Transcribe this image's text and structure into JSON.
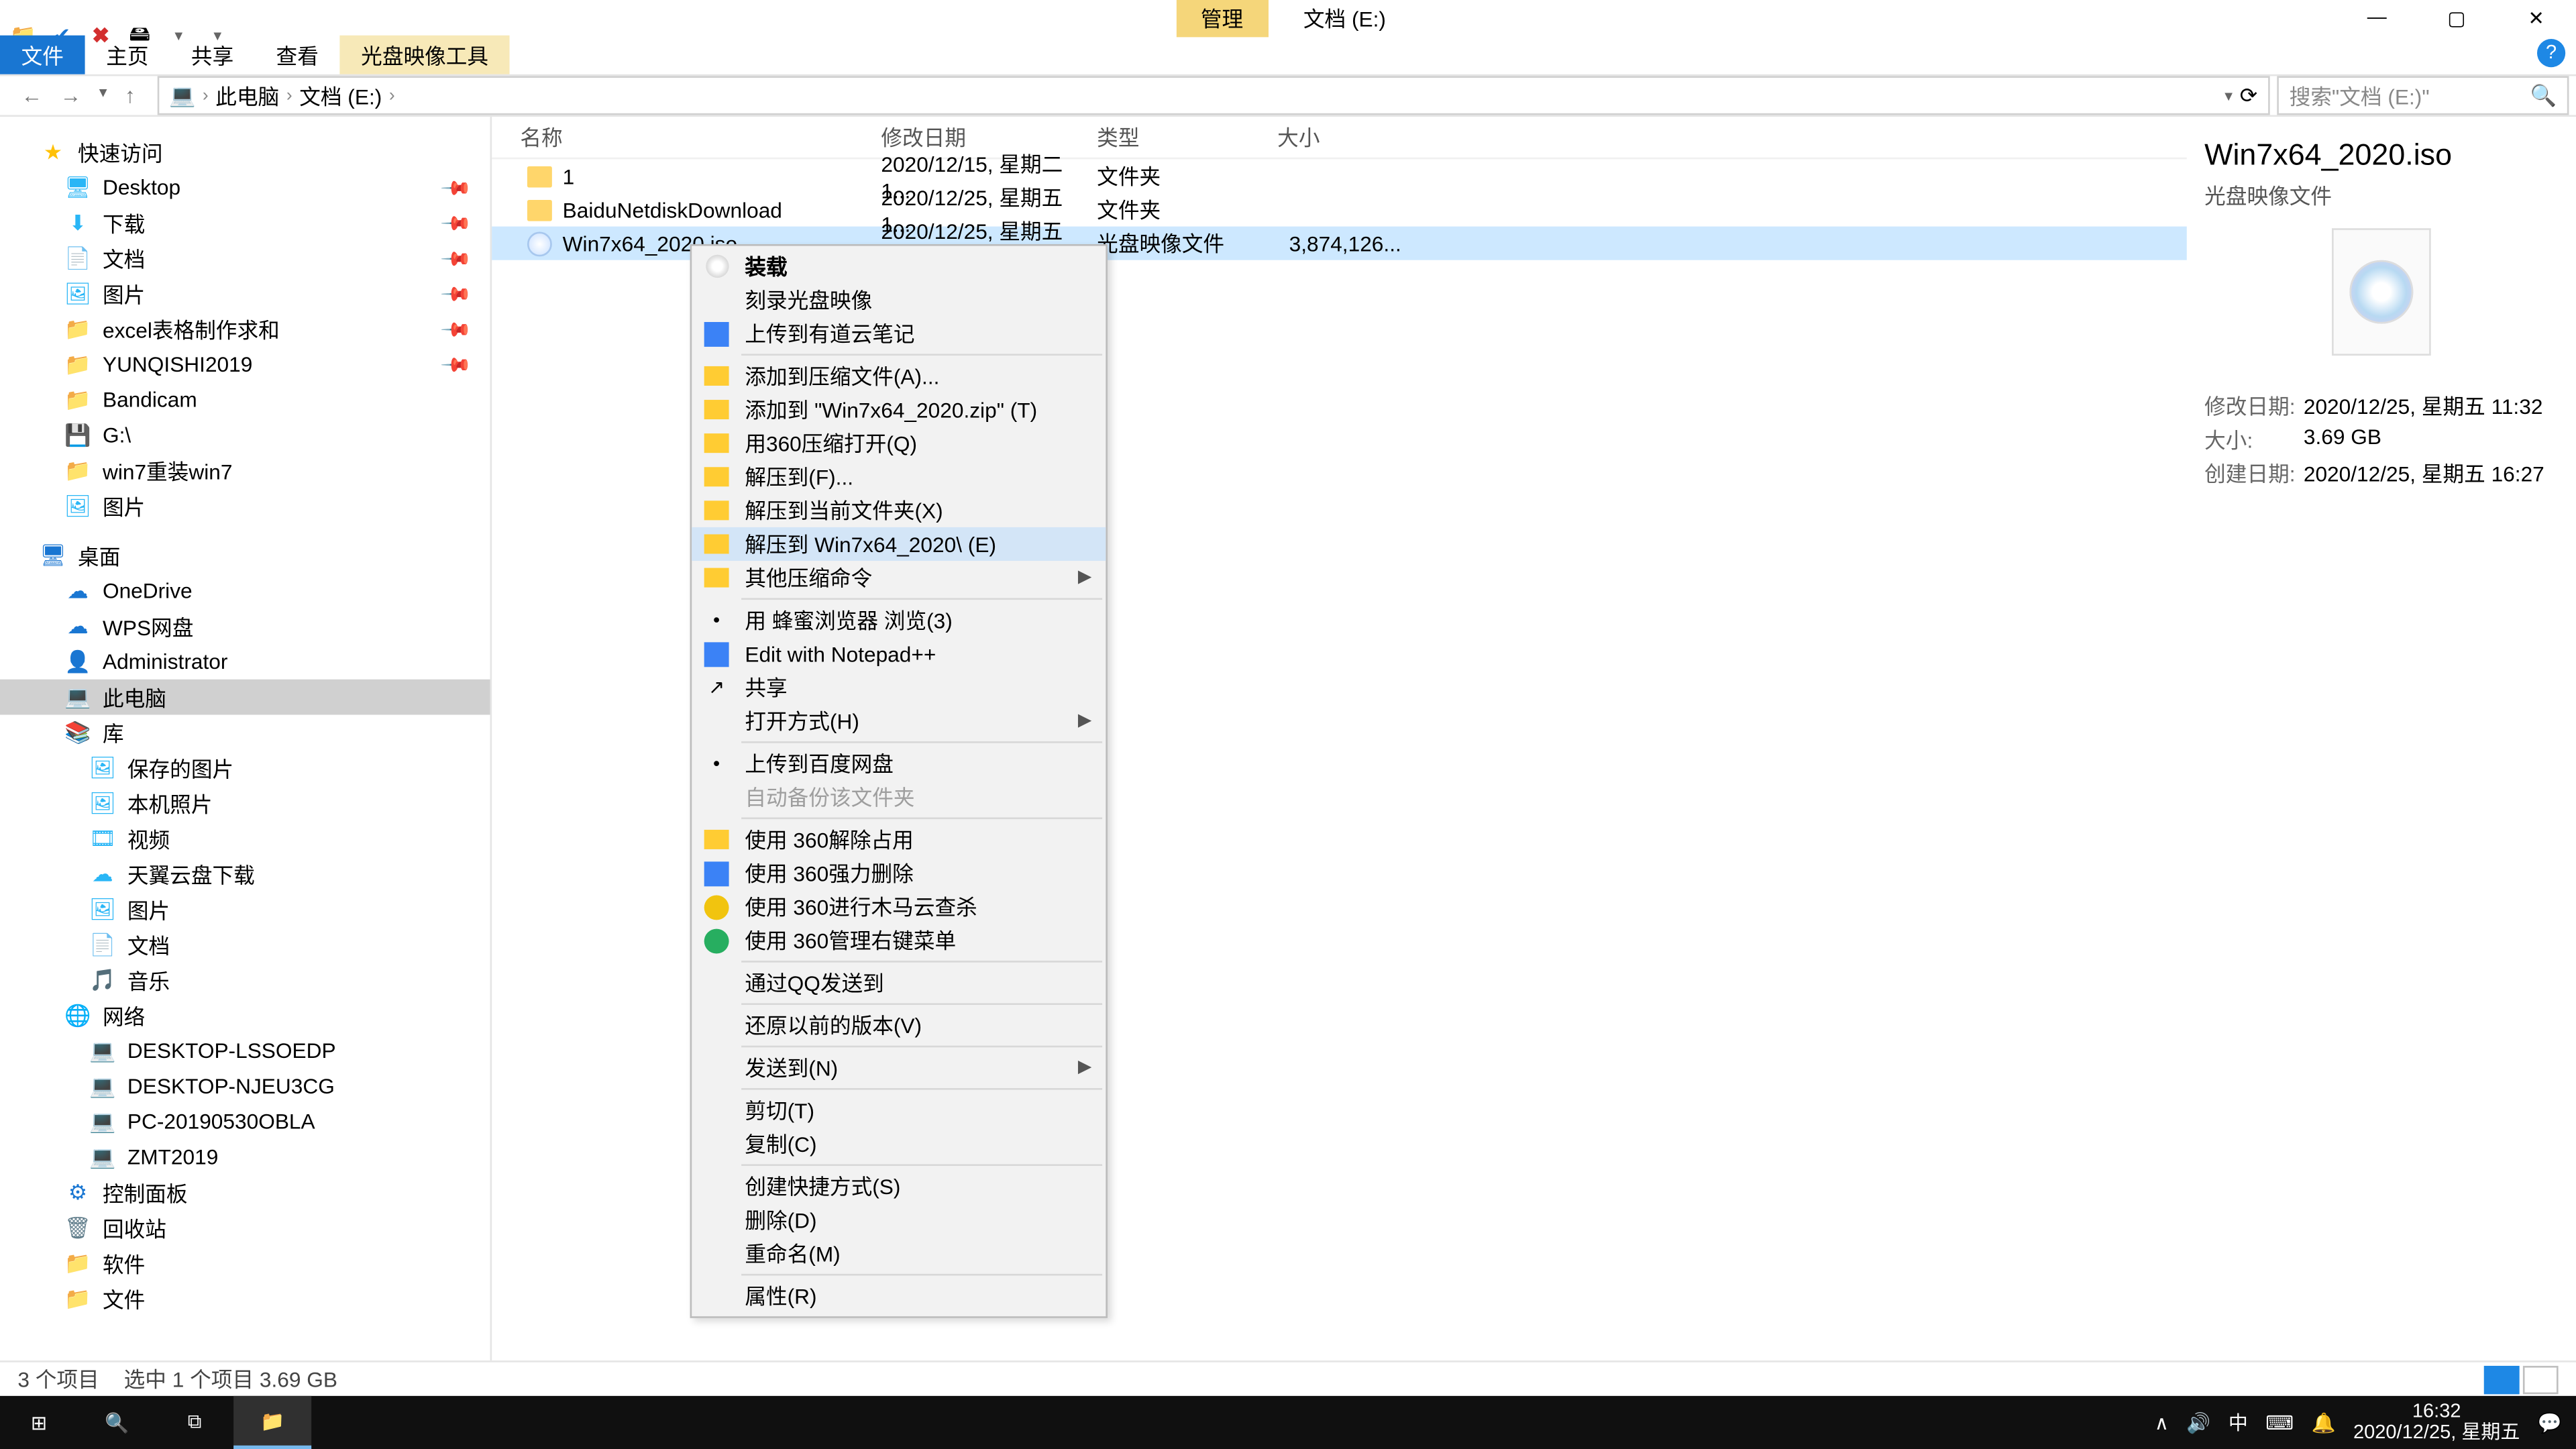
{
  "window": {
    "qat": [
      "📁",
      "✔",
      "✖",
      "🖴",
      "▾",
      "▾"
    ],
    "title_tab": "管理",
    "title_location": "文档 (E:)",
    "ribbon": {
      "file": "文件",
      "home": "主页",
      "share": "共享",
      "view": "查看",
      "tool": "光盘映像工具"
    },
    "ctrl": {
      "min": "—",
      "max": "▢",
      "close": "✕",
      "help": "?"
    }
  },
  "address": {
    "back": "←",
    "fwd": "→",
    "up": "↑",
    "crumbs": [
      "此电脑",
      "文档 (E:)"
    ],
    "search_ph": "搜索\"文档 (E:)\""
  },
  "tree": [
    {
      "lvl": 1,
      "icon": "★",
      "label": "快速访问",
      "col": "#ffc107"
    },
    {
      "lvl": 2,
      "icon": "🖥",
      "label": "Desktop",
      "col": "#29b6f6",
      "pin": true
    },
    {
      "lvl": 2,
      "icon": "⬇",
      "label": "下载",
      "col": "#29b6f6",
      "pin": true
    },
    {
      "lvl": 2,
      "icon": "📄",
      "label": "文档",
      "col": "#29b6f6",
      "pin": true
    },
    {
      "lvl": 2,
      "icon": "🖼",
      "label": "图片",
      "col": "#29b6f6",
      "pin": true
    },
    {
      "lvl": 2,
      "icon": "📁",
      "label": "excel表格制作求和",
      "col": "#ffc107",
      "pin": true
    },
    {
      "lvl": 2,
      "icon": "📁",
      "label": "YUNQISHI2019",
      "col": "#ffc107",
      "pin": true
    },
    {
      "lvl": 2,
      "icon": "📁",
      "label": "Bandicam",
      "col": "#ffc107"
    },
    {
      "lvl": 2,
      "icon": "💾",
      "label": "G:\\",
      "col": "#90a4ae"
    },
    {
      "lvl": 2,
      "icon": "📁",
      "label": "win7重装win7",
      "col": "#ffc107"
    },
    {
      "lvl": 2,
      "icon": "🖼",
      "label": "图片",
      "col": "#29b6f6"
    },
    {
      "gap": true
    },
    {
      "lvl": 1,
      "icon": "🖥",
      "label": "桌面",
      "col": "#1976d2"
    },
    {
      "lvl": 2,
      "icon": "☁",
      "label": "OneDrive",
      "col": "#1976d2"
    },
    {
      "lvl": 2,
      "icon": "☁",
      "label": "WPS网盘",
      "col": "#1976d2"
    },
    {
      "lvl": 2,
      "icon": "👤",
      "label": "Administrator",
      "col": "#607d8b"
    },
    {
      "lvl": 2,
      "icon": "💻",
      "label": "此电脑",
      "col": "#607d8b",
      "selected": true
    },
    {
      "lvl": 2,
      "icon": "📚",
      "label": "库",
      "col": "#29b6f6"
    },
    {
      "lvl": 3,
      "icon": "🖼",
      "label": "保存的图片",
      "col": "#29b6f6"
    },
    {
      "lvl": 3,
      "icon": "🖼",
      "label": "本机照片",
      "col": "#29b6f6"
    },
    {
      "lvl": 3,
      "icon": "🎞",
      "label": "视频",
      "col": "#29b6f6"
    },
    {
      "lvl": 3,
      "icon": "☁",
      "label": "天翼云盘下载",
      "col": "#29b6f6"
    },
    {
      "lvl": 3,
      "icon": "🖼",
      "label": "图片",
      "col": "#29b6f6"
    },
    {
      "lvl": 3,
      "icon": "📄",
      "label": "文档",
      "col": "#29b6f6"
    },
    {
      "lvl": 3,
      "icon": "🎵",
      "label": "音乐",
      "col": "#29b6f6"
    },
    {
      "lvl": 2,
      "icon": "🌐",
      "label": "网络",
      "col": "#1976d2"
    },
    {
      "lvl": 3,
      "icon": "💻",
      "label": "DESKTOP-LSSOEDP",
      "col": "#607d8b"
    },
    {
      "lvl": 3,
      "icon": "💻",
      "label": "DESKTOP-NJEU3CG",
      "col": "#607d8b"
    },
    {
      "lvl": 3,
      "icon": "💻",
      "label": "PC-20190530OBLA",
      "col": "#607d8b"
    },
    {
      "lvl": 3,
      "icon": "💻",
      "label": "ZMT2019",
      "col": "#607d8b"
    },
    {
      "lvl": 2,
      "icon": "⚙",
      "label": "控制面板",
      "col": "#1976d2"
    },
    {
      "lvl": 2,
      "icon": "🗑",
      "label": "回收站",
      "col": "#607d8b"
    },
    {
      "lvl": 2,
      "icon": "📁",
      "label": "软件",
      "col": "#ffc107"
    },
    {
      "lvl": 2,
      "icon": "📁",
      "label": "文件",
      "col": "#ffc107"
    }
  ],
  "columns": {
    "name": "名称",
    "date": "修改日期",
    "type": "类型",
    "size": "大小"
  },
  "files": [
    {
      "kind": "folder",
      "name": "1",
      "date": "2020/12/15, 星期二 1...",
      "type": "文件夹",
      "size": ""
    },
    {
      "kind": "folder",
      "name": "BaiduNetdiskDownload",
      "date": "2020/12/25, 星期五 1...",
      "type": "文件夹",
      "size": ""
    },
    {
      "kind": "iso",
      "name": "Win7x64_2020.iso",
      "date": "2020/12/25, 星期五 1...",
      "type": "光盘映像文件",
      "size": "3,874,126...",
      "selected": true
    }
  ],
  "context_menu": [
    {
      "label": "装载",
      "icon": "disc",
      "bold": true
    },
    {
      "label": "刻录光盘映像"
    },
    {
      "label": "上传到有道云笔记",
      "icon": "blue"
    },
    {
      "sep": true
    },
    {
      "label": "添加到压缩文件(A)...",
      "icon": "ybox"
    },
    {
      "label": "添加到 \"Win7x64_2020.zip\" (T)",
      "icon": "ybox"
    },
    {
      "label": "用360压缩打开(Q)",
      "icon": "ybox"
    },
    {
      "label": "解压到(F)...",
      "icon": "ybox"
    },
    {
      "label": "解压到当前文件夹(X)",
      "icon": "ybox"
    },
    {
      "label": "解压到 Win7x64_2020\\ (E)",
      "icon": "ybox",
      "hover": true
    },
    {
      "label": "其他压缩命令",
      "icon": "ybox",
      "arrow": true
    },
    {
      "sep": true
    },
    {
      "label": "用 蜂蜜浏览器 浏览(3)",
      "icon": "dot"
    },
    {
      "label": "Edit with Notepad++",
      "icon": "gbox"
    },
    {
      "label": "共享",
      "icon": "share"
    },
    {
      "label": "打开方式(H)",
      "arrow": true
    },
    {
      "sep": true
    },
    {
      "label": "上传到百度网盘",
      "icon": "dot"
    },
    {
      "label": "自动备份该文件夹",
      "disabled": true
    },
    {
      "sep": true
    },
    {
      "label": "使用 360解除占用",
      "icon": "ybox"
    },
    {
      "label": "使用 360强力删除",
      "icon": "pbox"
    },
    {
      "label": "使用 360进行木马云查杀",
      "icon": "ycir"
    },
    {
      "label": "使用 360管理右键菜单",
      "icon": "gcir"
    },
    {
      "sep": true
    },
    {
      "label": "通过QQ发送到"
    },
    {
      "sep": true
    },
    {
      "label": "还原以前的版本(V)"
    },
    {
      "sep": true
    },
    {
      "label": "发送到(N)",
      "arrow": true
    },
    {
      "sep": true
    },
    {
      "label": "剪切(T)"
    },
    {
      "label": "复制(C)"
    },
    {
      "sep": true
    },
    {
      "label": "创建快捷方式(S)"
    },
    {
      "label": "删除(D)"
    },
    {
      "label": "重命名(M)"
    },
    {
      "sep": true
    },
    {
      "label": "属性(R)"
    }
  ],
  "preview": {
    "title": "Win7x64_2020.iso",
    "subtitle": "光盘映像文件",
    "rows": [
      {
        "k": "修改日期:",
        "v": "2020/12/25, 星期五 11:32"
      },
      {
        "k": "大小:",
        "v": "3.69 GB"
      },
      {
        "k": "创建日期:",
        "v": "2020/12/25, 星期五 16:27"
      }
    ]
  },
  "status": {
    "items": "3 个项目",
    "sel": "选中 1 个项目  3.69 GB"
  },
  "taskbar": {
    "tray": [
      "∧",
      "🔊",
      "中",
      "⌨",
      "🔔"
    ],
    "time": "16:32",
    "date": "2020/12/25, 星期五"
  }
}
